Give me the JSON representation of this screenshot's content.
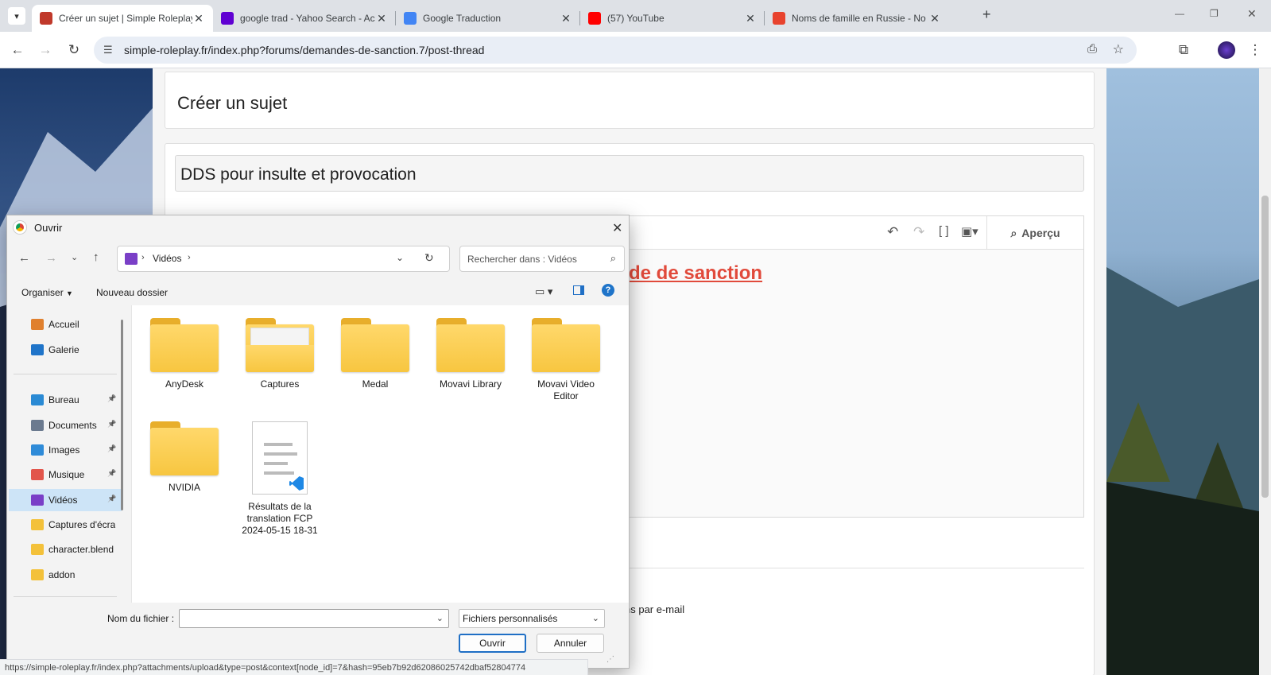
{
  "tabs": [
    {
      "title": "Créer un sujet | Simple Roleplay",
      "favicon_color": "#c0392b",
      "active": true
    },
    {
      "title": "google trad - Yahoo Search - Ac",
      "favicon_color": "#6001d2",
      "active": false
    },
    {
      "title": "Google Traduction",
      "favicon_color": "#4285f4",
      "active": false
    },
    {
      "title": "(57) YouTube",
      "favicon_color": "#ff0000",
      "active": false
    },
    {
      "title": "Noms de famille en Russie - No",
      "favicon_color": "#e8432e",
      "active": false
    }
  ],
  "new_tab_symbol": "+",
  "window_controls": {
    "minimize": "—",
    "restore": "❐",
    "close": "✕"
  },
  "url": "simple-roleplay.fr/index.php?forums/demandes-de-sanction.7/post-thread",
  "page": {
    "header_title": "Créer un sujet",
    "thread_title_value": "DDS pour insulte et provocation",
    "editor_heading_visible": "de de sanction",
    "preview_label": "Aperçu",
    "email_option_visible": "ns par e-mail"
  },
  "dialog": {
    "title": "Ouvrir",
    "breadcrumb": [
      "Vidéos"
    ],
    "search_placeholder": "Rechercher dans : Vidéos",
    "organize_label": "Organiser",
    "new_folder_label": "Nouveau dossier",
    "nav_items": [
      {
        "label": "Accueil",
        "icon": "home-icon",
        "color": "#e0802e",
        "pinned": false
      },
      {
        "label": "Galerie",
        "icon": "gallery-icon",
        "color": "#1f74c9",
        "pinned": false
      },
      {
        "label": "Bureau",
        "icon": "desktop-icon",
        "color": "#2a8ad4",
        "pinned": true
      },
      {
        "label": "Documents",
        "icon": "documents-icon",
        "color": "#6b7a8f",
        "pinned": true
      },
      {
        "label": "Images",
        "icon": "images-icon",
        "color": "#2f8bd8",
        "pinned": true
      },
      {
        "label": "Musique",
        "icon": "music-icon",
        "color": "#e2554b",
        "pinned": true
      },
      {
        "label": "Vidéos",
        "icon": "videos-icon",
        "color": "#7a3fc7",
        "pinned": true,
        "selected": true
      },
      {
        "label": "Captures d'écran",
        "icon": "folder-icon",
        "color": "#f3c13a",
        "pinned": false
      },
      {
        "label": "character.blend",
        "icon": "folder-icon",
        "color": "#f3c13a",
        "pinned": false
      },
      {
        "label": "addon",
        "icon": "folder-icon",
        "color": "#f3c13a",
        "pinned": false
      }
    ],
    "files": [
      {
        "name": "AnyDesk",
        "type": "folder"
      },
      {
        "name": "Captures",
        "type": "folder-preview"
      },
      {
        "name": "Medal",
        "type": "folder"
      },
      {
        "name": "Movavi Library",
        "type": "folder"
      },
      {
        "name": "Movavi Video Editor",
        "type": "folder"
      },
      {
        "name": "NVIDIA",
        "type": "folder"
      },
      {
        "name": "Résultats de la translation FCP 2024-05-15 18-31",
        "type": "file"
      }
    ],
    "filename_label": "Nom du fichier :",
    "filename_value": "",
    "filter_value": "Fichiers personnalisés",
    "open_button": "Ouvrir",
    "cancel_button": "Annuler"
  },
  "status_url": "https://simple-roleplay.fr/index.php?attachments/upload&type=post&context[node_id]=7&hash=95eb7b92d62086025742dbaf52804774"
}
